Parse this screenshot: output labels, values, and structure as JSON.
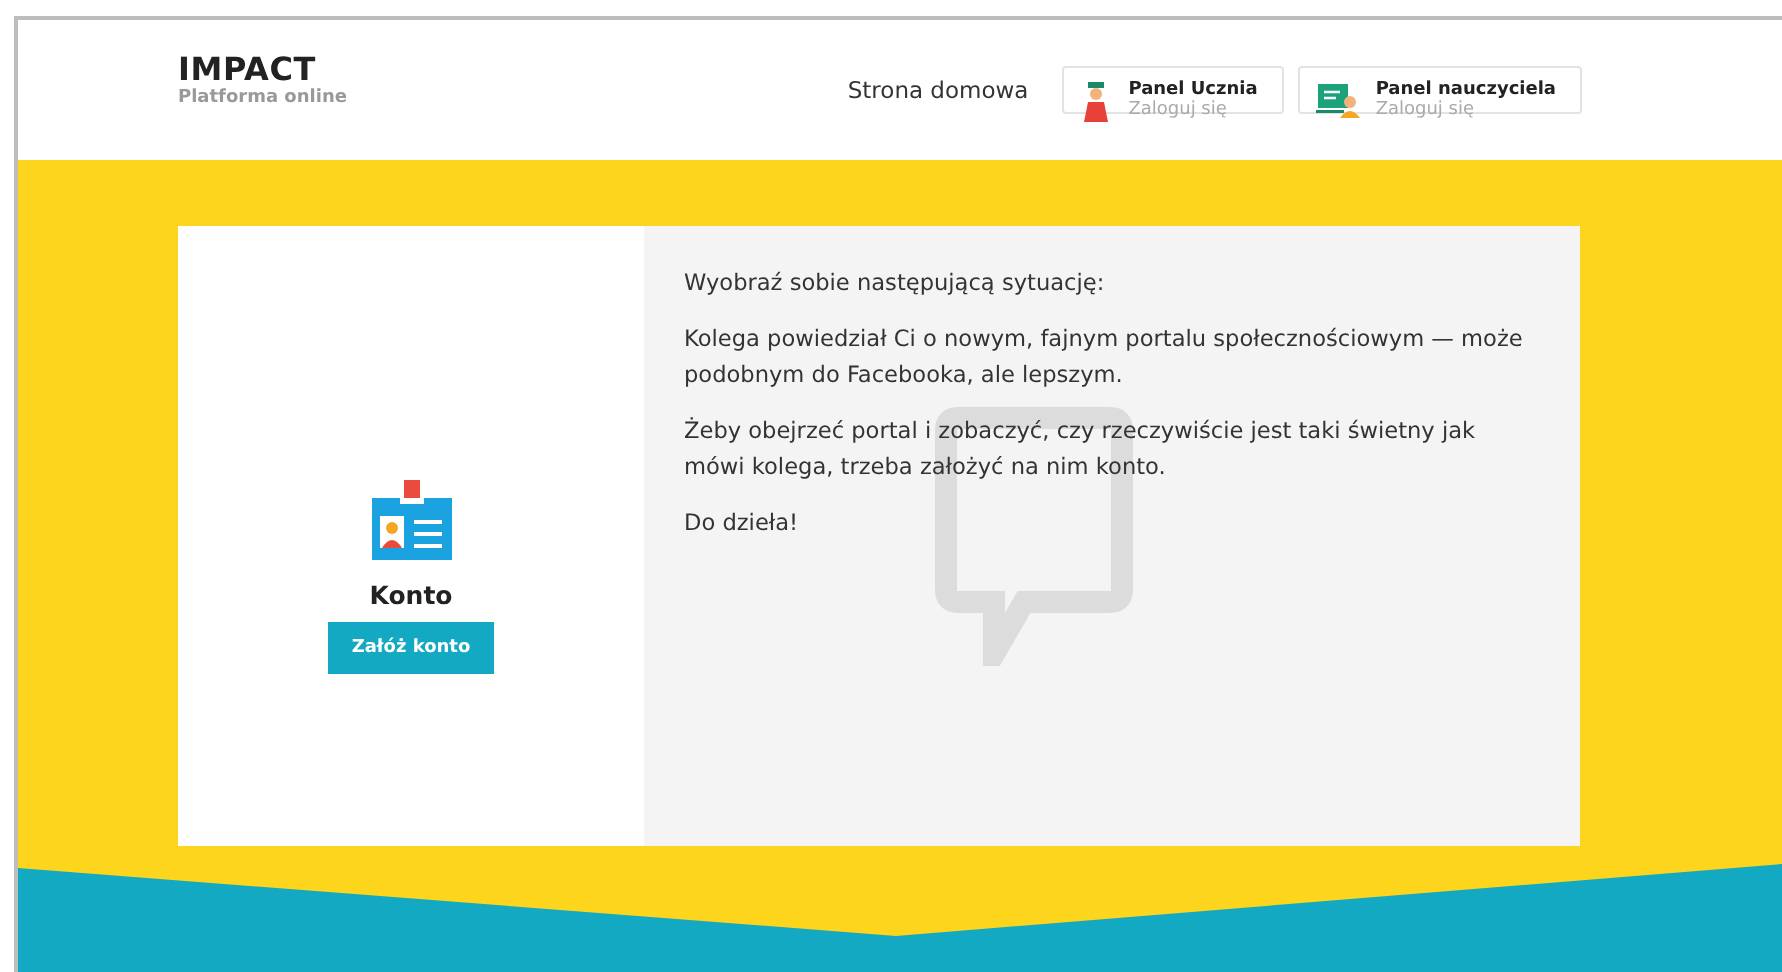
{
  "brand": {
    "title": "IMPACT",
    "subtitle": "Platforma online"
  },
  "nav": {
    "home_link": "Strona domowa",
    "panels": [
      {
        "kind": "student",
        "title": "Panel Ucznia",
        "action": "Zaloguj się"
      },
      {
        "kind": "teacher",
        "title": "Panel nauczyciela",
        "action": "Zaloguj się"
      }
    ]
  },
  "account": {
    "title": "Konto",
    "button": "Załóż konto"
  },
  "story": {
    "paragraphs": [
      "Wyobraź sobie następującą sytuację:",
      "Kolega powiedział Ci o nowym, fajnym portalu społecznościowym — może podobnym do Facebooka, ale lepszym.",
      "Żeby obejrzeć portal i zobaczyć, czy rzeczywiście jest taki świetny jak mówi kolega, trzeba założyć na nim konto.",
      "Do dzieła!"
    ]
  }
}
